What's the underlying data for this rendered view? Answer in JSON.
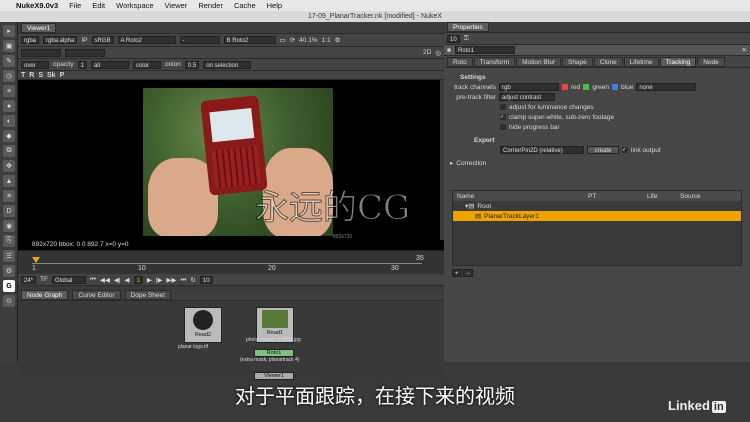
{
  "menubar": {
    "app": "NukeX9.0v3",
    "items": [
      "File",
      "Edit",
      "Workspace",
      "Viewer",
      "Render",
      "Cache",
      "Help"
    ]
  },
  "window": {
    "title": "17-09_PlanarTracker.nk [modified] - NukeX"
  },
  "viewer_panel": {
    "tab": "Viewer1",
    "toolbar1": {
      "channels": "rgba",
      "alpha": "rgba.alpha",
      "ip": "IP",
      "colorspace": "sRGB",
      "input_a": "A  Roto2",
      "input_b": "B  Roto2",
      "zoom": "40.1%",
      "ratio": "1:1",
      "mode": "2D"
    },
    "toolbar2": {
      "blend": "over",
      "opacity_label": "opacity",
      "opacity": "1",
      "channels": "all",
      "color": "color",
      "onion_label": "onion",
      "onion": "0.5",
      "on_selection": "on selection"
    },
    "status": "892x720  bbox: 0 0 892 7  x=0 y=0",
    "resolution_label": "892x720",
    "timeline": {
      "ticks": [
        "1",
        "10",
        "20",
        "30",
        "35"
      ],
      "start": "1",
      "end": "35",
      "fps": "24*",
      "tf": "TF",
      "global": "Global",
      "frame": "1",
      "step": "10"
    }
  },
  "graph_panel": {
    "tabs": [
      "Node Graph",
      "Curve Editor",
      "Dope Sheet"
    ],
    "nodes": [
      {
        "name": "Read2",
        "file": "planar logo.tif"
      },
      {
        "name": "Read1",
        "file": "phone insert v2.0001.jpg"
      },
      {
        "name": "Roto1",
        "desc": "(extra mask, planartrack 4)"
      },
      {
        "name": "Viewer1"
      }
    ]
  },
  "properties": {
    "title": "Properties",
    "count": "10",
    "node": "Roto1",
    "tabs": [
      "Roto",
      "Transform",
      "Motion Blur",
      "Shape",
      "Clone",
      "Lifetime",
      "Tracking",
      "Node"
    ],
    "active_tab": "Tracking",
    "settings_label": "Settings",
    "track_channels_label": "track channels",
    "track_channels": "rgb",
    "ch_red": "red",
    "ch_green": "green",
    "ch_blue": "blue",
    "ch_extra": "none",
    "pretrack_label": "pre-track filter",
    "pretrack": "adjust contrast",
    "opt1": "adjust for luminance changes",
    "opt2": "clamp super-white, sub-zero footage",
    "opt3": "hide progress bar",
    "export_label": "Export",
    "export_type": "CornerPin2D (relative)",
    "create": "create",
    "link_output": "link output",
    "correction": "Correction",
    "table_headers": [
      "Name",
      "PT",
      "Life",
      "Source"
    ],
    "layers": [
      "Root",
      "PlanarTrackLayer1"
    ],
    "colors": {
      "selected_row": "#f0a300",
      "accent": "#e04848"
    }
  },
  "overlay": {
    "subtitle": "对于平面跟踪，在接下来的视频",
    "watermark": "永远的CG",
    "brand": "Linked",
    "brand_in": "in"
  }
}
